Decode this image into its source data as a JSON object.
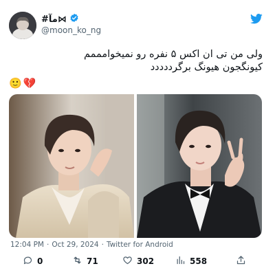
{
  "user": {
    "display_name": "#مآ⋈",
    "handle": "@moon_ko_ng",
    "verified": true
  },
  "tweet": {
    "text_lines": [
      "ولی من تی ان اکس ۵ نفره رو نمیخوامممم",
      "کیونگجون هیونگ برگرددددد"
    ],
    "emojis": [
      "🙂",
      "💔"
    ]
  },
  "media": {
    "count": 2
  },
  "meta": {
    "time": "12:04 PM",
    "separator1": "·",
    "date": "Oct 29, 2024",
    "separator2": "·",
    "source": "Twitter for Android"
  },
  "actions": {
    "replies": "0",
    "retweets": "71",
    "likes": "302",
    "views": "558"
  },
  "icons": {
    "brand": "twitter-bird-icon",
    "verified": "verified-badge-icon",
    "reply": "reply-icon",
    "retweet": "retweet-icon",
    "like": "heart-icon",
    "views": "views-chart-icon",
    "share": "share-icon"
  },
  "colors": {
    "brand": "#1d9bf0",
    "text": "#0f1419",
    "secondary": "#536471"
  }
}
